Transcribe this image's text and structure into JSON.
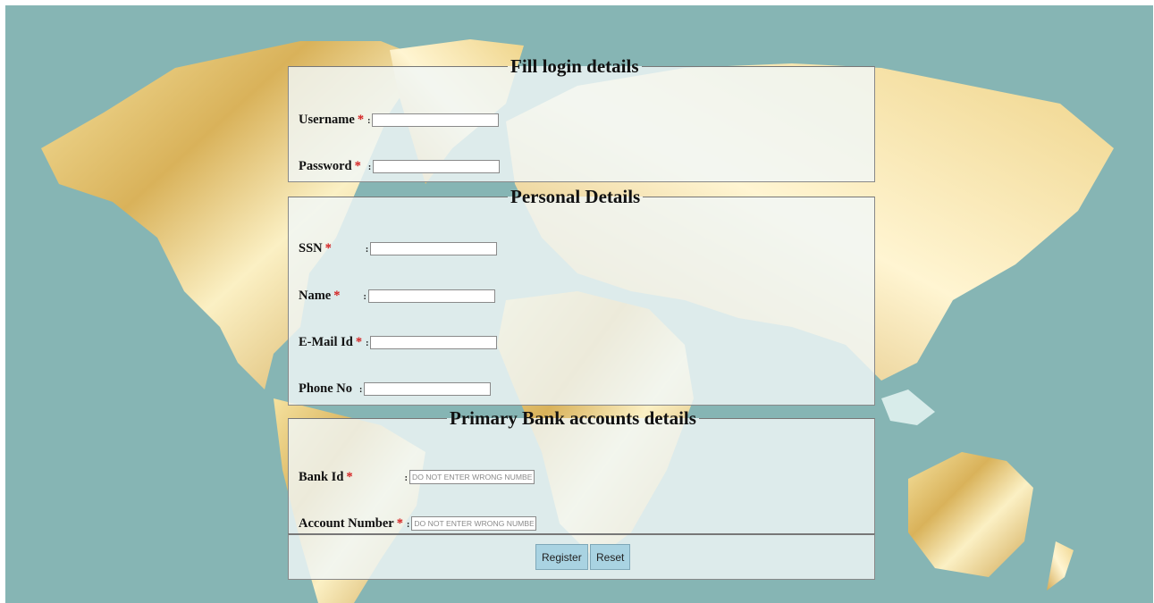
{
  "login": {
    "legend": "Fill login details",
    "username_label": "Username",
    "password_label": "Password"
  },
  "personal": {
    "legend": "Personal Details",
    "ssn_label": "SSN",
    "name_label": "Name",
    "email_label": "E-Mail Id",
    "phone_label": "Phone No"
  },
  "bank": {
    "legend": "Primary Bank accounts details",
    "bank_id_label": "Bank Id",
    "account_label": "Account Number",
    "bank_id_placeholder": "DO NOT ENTER WRONG NUMBER",
    "account_placeholder": "DO NOT ENTER WRONG NUMBER"
  },
  "actions": {
    "register_label": "Register",
    "reset_label": "Reset"
  },
  "symbols": {
    "required": "*",
    "colon": ":"
  },
  "colors": {
    "background_ocean": "#86b5b4",
    "land_gold": "#e6c87a",
    "required_star": "#d42020",
    "button_bg": "#a9d3e2"
  }
}
